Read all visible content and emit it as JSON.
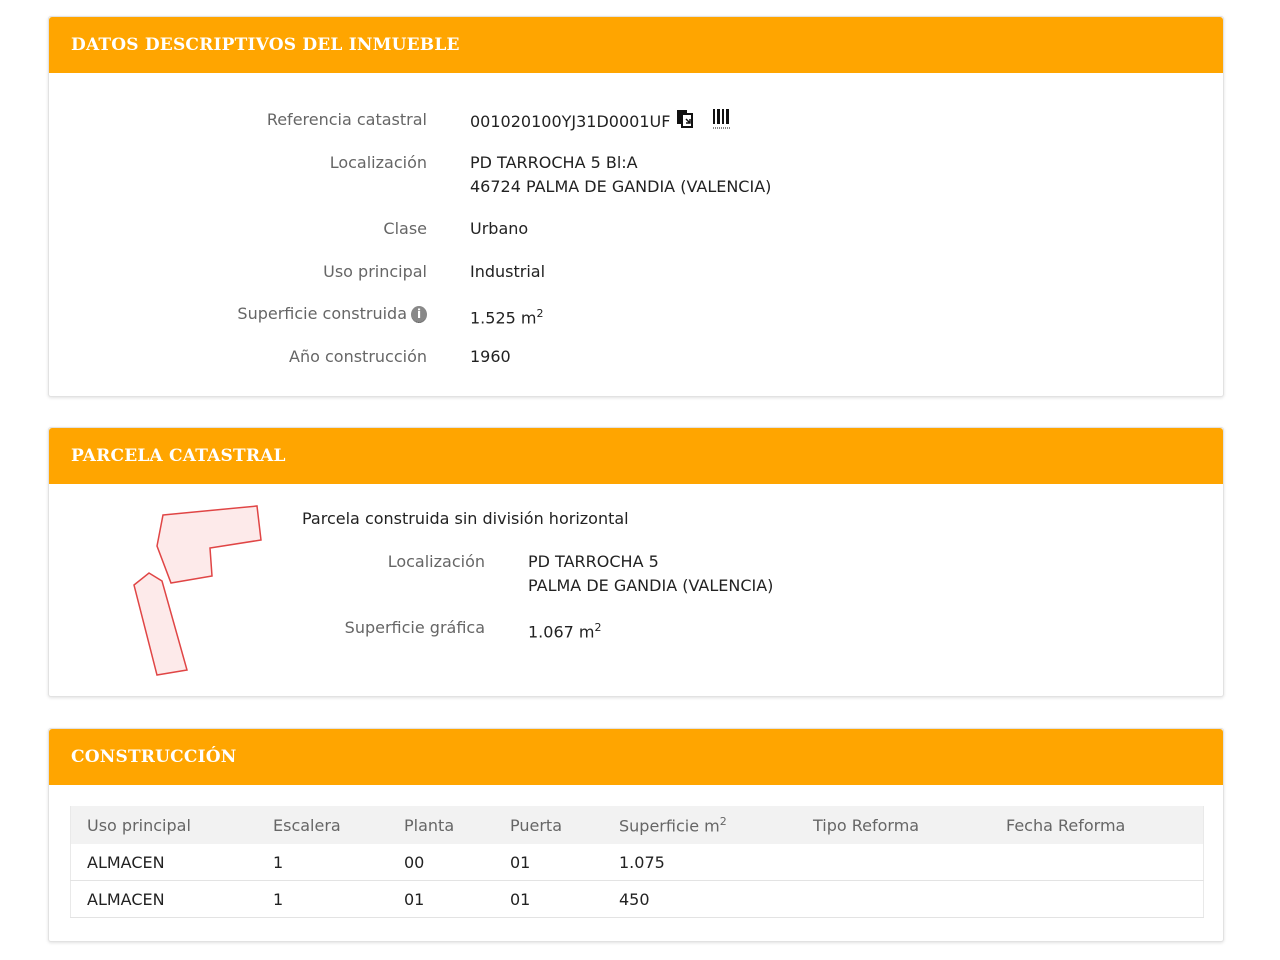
{
  "datos": {
    "header": "DATOS DESCRIPTIVOS DEL INMUEBLE",
    "ref_label": "Referencia catastral",
    "ref_value": "001020100YJ31D0001UF",
    "loc_label": "Localización",
    "loc_line1": "PD TARROCHA 5 Bl:A",
    "loc_line2": "46724 PALMA DE GANDIA (VALENCIA)",
    "clase_label": "Clase",
    "clase_value": "Urbano",
    "uso_label": "Uso principal",
    "uso_value": "Industrial",
    "sup_label": "Superficie construida",
    "sup_value": "1.525 m",
    "sup_exp": "2",
    "anio_label": "Año construcción",
    "anio_value": "1960"
  },
  "parcela": {
    "header": "PARCELA CATASTRAL",
    "title": "Parcela construida sin división horizontal",
    "loc_label": "Localización",
    "loc_line1": "PD TARROCHA 5",
    "loc_line2": "PALMA DE GANDIA (VALENCIA)",
    "sup_label": "Superficie gráfica",
    "sup_value": "1.067 m",
    "sup_exp": "2"
  },
  "construccion": {
    "header": "CONSTRUCCIÓN",
    "columns": [
      "Uso principal",
      "Escalera",
      "Planta",
      "Puerta",
      "Superficie m",
      "Tipo Reforma",
      "Fecha Reforma"
    ],
    "sup_col_exp": "2",
    "rows": [
      [
        "ALMACEN",
        "1",
        "00",
        "01",
        "1.075",
        "",
        ""
      ],
      [
        "ALMACEN",
        "1",
        "01",
        "01",
        "450",
        "",
        ""
      ]
    ]
  },
  "colors": {
    "header_bg": "#ffa500",
    "parcel_fill": "#fdeaea",
    "parcel_stroke": "#e04545"
  },
  "icons": {
    "copy": "copy-icon",
    "barcode": "barcode-icon",
    "info": "info-icon"
  }
}
